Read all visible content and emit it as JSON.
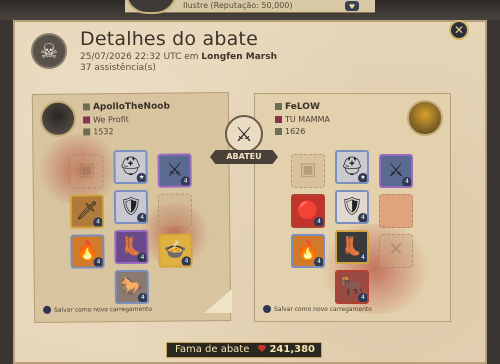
{
  "top_strip": {
    "text": "Ilustre (Reputação: 50,000)"
  },
  "header": {
    "title": "Detalhes do abate",
    "date": "25/07/2026 22:32 UTC em",
    "location": "Longfen Marsh",
    "assists": "37 assistência(s)"
  },
  "killer": {
    "name": "ApolloTheNoob",
    "guild": "We Profit",
    "ip": "1532",
    "save_label": "Salvar como novo carregamento",
    "slots": [
      {
        "icon": "▣",
        "quality": ""
      },
      {
        "icon": "⛑",
        "quality": "★"
      },
      {
        "icon": "⚔",
        "quality": "4"
      },
      {
        "icon": "🗡",
        "quality": "4"
      },
      {
        "icon": "🛡",
        "quality": "4"
      },
      {
        "icon": "",
        "quality": ""
      },
      {
        "icon": "🔥",
        "quality": "4"
      },
      {
        "icon": "👢",
        "quality": "4"
      },
      {
        "icon": "🍲",
        "quality": "4"
      },
      {
        "icon": "🐎",
        "quality": "4"
      }
    ]
  },
  "victim": {
    "name": "FeLOW",
    "guild": "TU MAMMA",
    "ip": "1626",
    "save_label": "Salvar como novo carregamento",
    "slots": [
      {
        "icon": "",
        "quality": ""
      },
      {
        "icon": "⛑",
        "quality": "★"
      },
      {
        "icon": "⚔",
        "quality": "4"
      },
      {
        "icon": "🔴",
        "quality": "4"
      },
      {
        "icon": "🛡",
        "quality": "4"
      },
      {
        "icon": "",
        "quality": ""
      },
      {
        "icon": "🔥",
        "quality": "4"
      },
      {
        "icon": "👢",
        "quality": "4"
      },
      {
        "icon": "",
        "quality": ""
      },
      {
        "icon": "🐂",
        "quality": "4"
      }
    ]
  },
  "center": {
    "kill_label": "ABATEU"
  },
  "fame": {
    "label": "Fama de abate",
    "value": "241,380"
  },
  "colors": {
    "slot_border_blue": "#7a8ec0",
    "slot_border_purple": "#9a6ac0",
    "slot_border_gold": "#d1a540",
    "slot_border_red": "#b04030"
  }
}
